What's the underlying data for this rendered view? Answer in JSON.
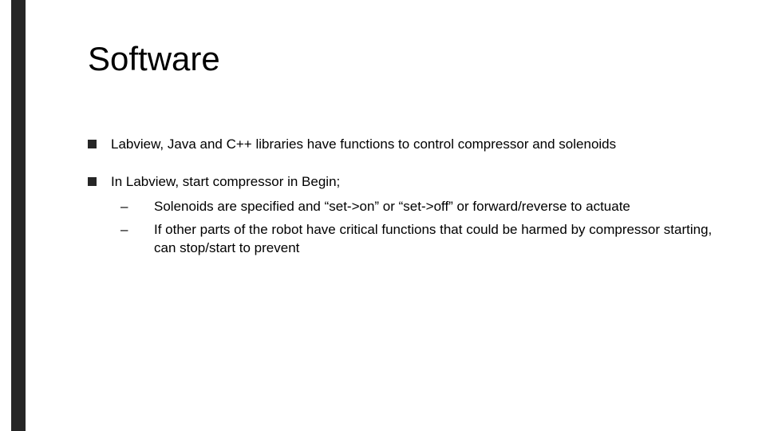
{
  "slide": {
    "title": "Software",
    "bullets": [
      {
        "text": "Labview, Java and C++ libraries have functions to control compressor and solenoids",
        "subs": []
      },
      {
        "text": "In Labview, start compressor in Begin;",
        "subs": [
          "Solenoids are specified and “set->on” or “set->off” or forward/reverse to actuate",
          "If other parts of the robot have critical functions that could be harmed by compressor starting, can stop/start to prevent"
        ]
      }
    ]
  }
}
